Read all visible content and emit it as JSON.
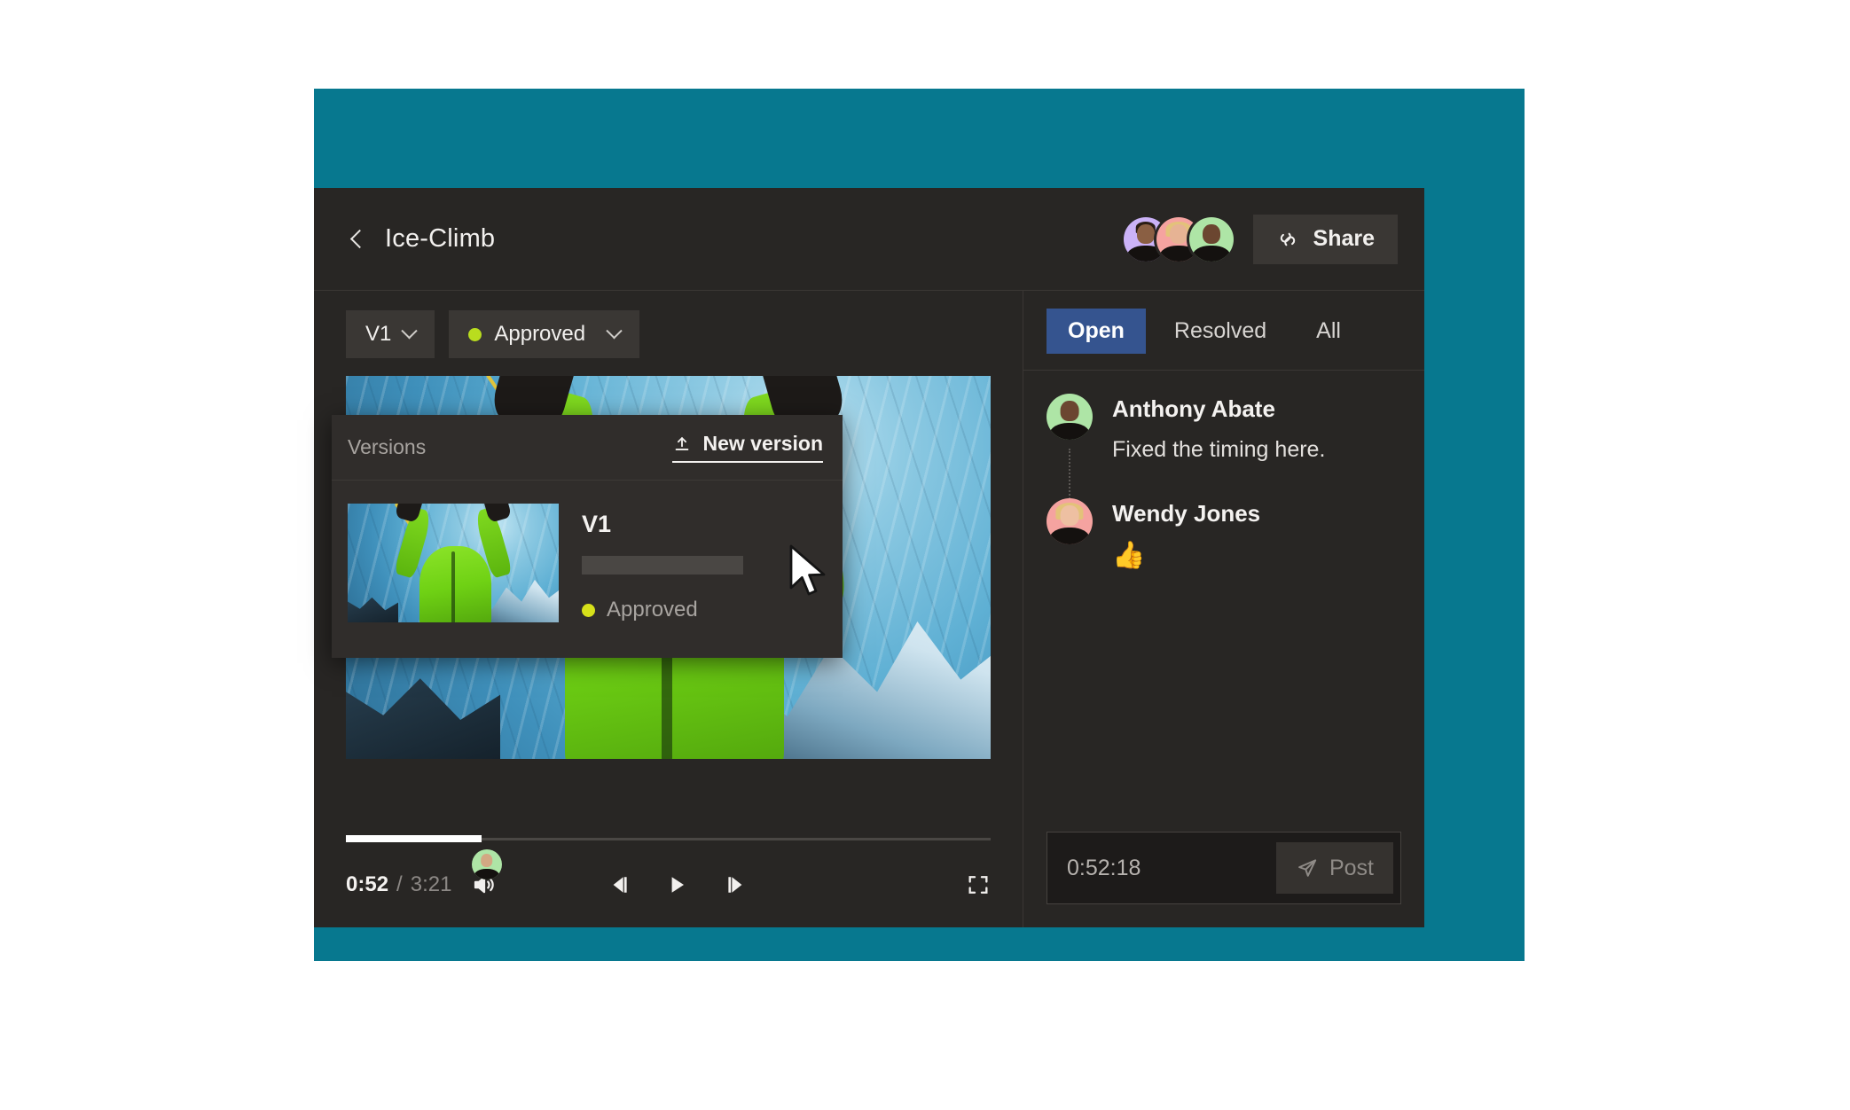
{
  "theme": {
    "backdrop": "#07788f",
    "panel_bg": "#282624",
    "chip_bg": "#3a3734",
    "accent_tab": "#35548f",
    "status_green": "#b9dd1e"
  },
  "topbar": {
    "back_icon": "chevron-left-icon",
    "title": "Ice-Climb",
    "avatars": [
      {
        "name": "collaborator-1",
        "bg": "#cbb2f7"
      },
      {
        "name": "collaborator-2",
        "bg": "#f5a3a0"
      },
      {
        "name": "collaborator-3",
        "bg": "#aee5a6"
      }
    ],
    "share": {
      "icon": "link-icon",
      "label": "Share"
    }
  },
  "player": {
    "version_chip": {
      "label": "V1",
      "icon": "chevron-down-icon"
    },
    "status_chip": {
      "label": "Approved",
      "dot_color": "#b9dd1e",
      "icon": "chevron-down-icon"
    },
    "versions_popover": {
      "title": "Versions",
      "new_version": {
        "label": "New version",
        "icon": "upload-icon"
      },
      "items": [
        {
          "name": "V1",
          "status": "Approved",
          "status_dot": "#d6e01a",
          "thumbnail": "ice-climb-frame"
        }
      ]
    },
    "transport": {
      "current_time": "0:52",
      "separator": "/",
      "total_time": "3:21",
      "progress_percent": 21,
      "volume_icon": "volume-icon",
      "prev_frame_icon": "prev-frame-icon",
      "play_icon": "play-icon",
      "next_frame_icon": "next-frame-icon",
      "fullscreen_icon": "fullscreen-icon",
      "marker_avatar_bg": "#aee5a6"
    }
  },
  "sidebar": {
    "tabs": [
      {
        "label": "Open",
        "active": true
      },
      {
        "label": "Resolved",
        "active": false
      },
      {
        "label": "All",
        "active": false
      }
    ],
    "comments": [
      {
        "author": "Anthony Abate",
        "avatar_bg": "#aee5a6",
        "text": "Fixed the timing here.",
        "emoji": ""
      },
      {
        "author": "Wendy Jones",
        "avatar_bg": "#f5a3a0",
        "text": "",
        "emoji": "👍"
      }
    ],
    "composer": {
      "timestamp": "0:52:18",
      "post": {
        "label": "Post",
        "icon": "send-icon"
      }
    }
  }
}
